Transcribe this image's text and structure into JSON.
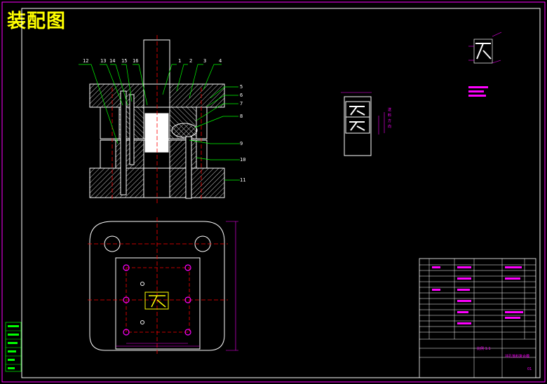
{
  "drawing": {
    "title": "装配图",
    "callouts": [
      "12",
      "13",
      "14",
      "15",
      "16",
      "1",
      "2",
      "3",
      "4",
      "5",
      "6",
      "7",
      "8",
      "9",
      "10",
      "11"
    ],
    "title_block": {
      "drawing_name": "冲孔落料复合模",
      "scale_label": "比例 1:1",
      "sheet_no": "01"
    }
  },
  "colors": {
    "border": "#ffffff",
    "hatch": "#ffffff",
    "centerline": "#ff0000",
    "dimension": "#ff00ff",
    "frame": "#00ff00",
    "title": "#ffff00"
  }
}
